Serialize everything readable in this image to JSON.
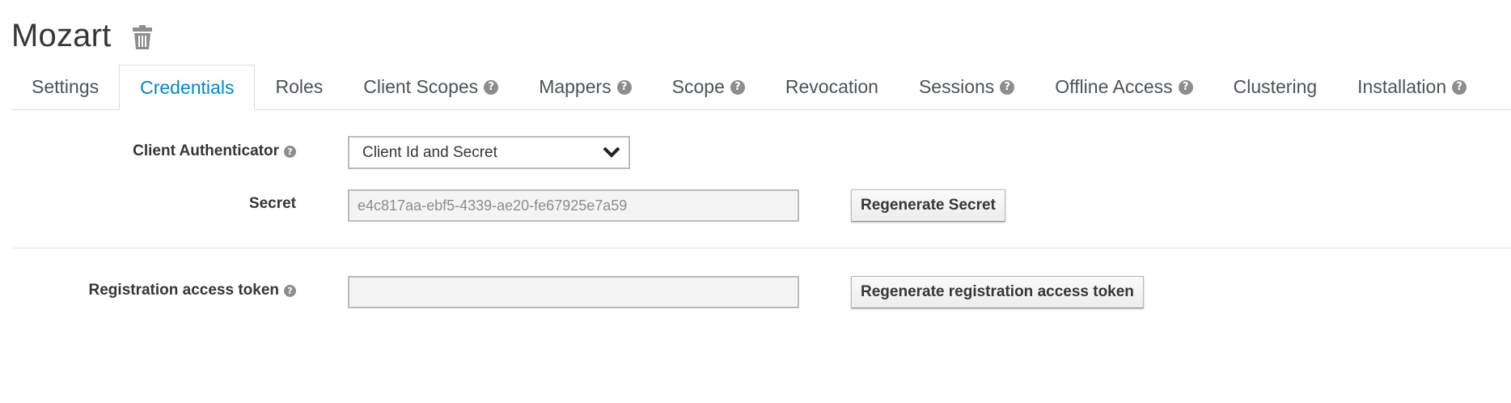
{
  "client": {
    "title": "Mozart"
  },
  "tabs": [
    {
      "label": "Settings",
      "help": false,
      "active": false
    },
    {
      "label": "Credentials",
      "help": false,
      "active": true
    },
    {
      "label": "Roles",
      "help": false,
      "active": false
    },
    {
      "label": "Client Scopes",
      "help": true,
      "active": false
    },
    {
      "label": "Mappers",
      "help": true,
      "active": false
    },
    {
      "label": "Scope",
      "help": true,
      "active": false
    },
    {
      "label": "Revocation",
      "help": false,
      "active": false
    },
    {
      "label": "Sessions",
      "help": true,
      "active": false
    },
    {
      "label": "Offline Access",
      "help": true,
      "active": false
    },
    {
      "label": "Clustering",
      "help": false,
      "active": false
    },
    {
      "label": "Installation",
      "help": true,
      "active": false
    }
  ],
  "form": {
    "authenticator_label": "Client Authenticator",
    "authenticator_value": "Client Id and Secret",
    "secret_label": "Secret",
    "secret_value": "e4c817aa-ebf5-4339-ae20-fe67925e7a59",
    "regenerate_secret_label": "Regenerate Secret",
    "registration_label": "Registration access token",
    "registration_value": "",
    "regenerate_registration_label": "Regenerate registration access token"
  },
  "icons": {
    "help": "?",
    "delete": "trash-icon",
    "dropdown": "chevron-down-icon"
  },
  "colors": {
    "active_tab": "#0088ce",
    "help_icon": "#8b8d8f"
  }
}
